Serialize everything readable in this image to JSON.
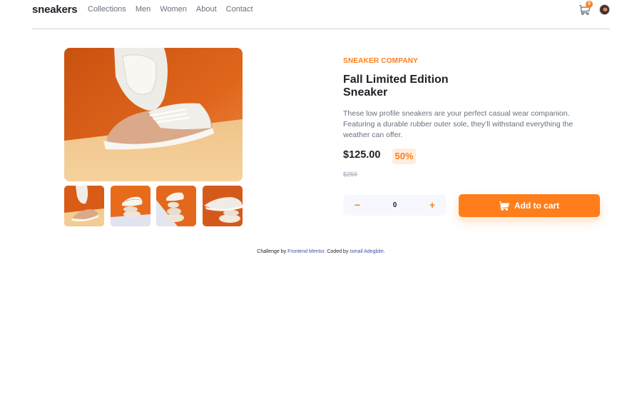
{
  "header": {
    "logo": "sneakers",
    "nav": [
      "Collections",
      "Men",
      "Women",
      "About",
      "Contact"
    ],
    "cart_count": "0"
  },
  "product": {
    "company": "SNEAKER COMPANY",
    "title": "Fall Limited Edition Sneaker",
    "description": "These low profile sneakers are your perfect casual wear companion. Featuring a durable rubber outer sole, they’ll withstand everything the weather can offer.",
    "price": "$125.00",
    "discount": "50%",
    "old_price": "$250",
    "quantity": "0",
    "minus": "−",
    "plus": "+",
    "add_to_cart": "Add to cart"
  },
  "footer": {
    "prefix": "Challenge by",
    "challenge_link": "Frontend Mentor",
    "middle": ". Coded by",
    "author_link": "Ismail Adegbite",
    "suffix": "."
  },
  "colors": {
    "accent": "#ff7e1b",
    "accent_pale": "#ffede0",
    "text_dark": "#1d2026",
    "text_gray": "#68707d",
    "link_blue": "#3e52a3"
  },
  "icons": [
    "cart-icon",
    "avatar",
    "cart-icon"
  ]
}
